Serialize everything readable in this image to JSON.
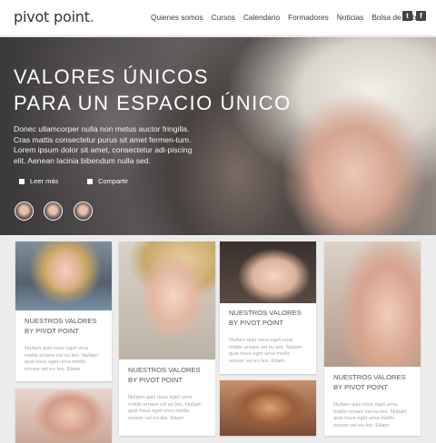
{
  "brand": {
    "name_main": "pivot point",
    "dot": "."
  },
  "nav": {
    "items": [
      "Quienes somos",
      "Cursos",
      "Calendario",
      "Formadores",
      "Noticias",
      "Bolsa de trabajo"
    ]
  },
  "social": {
    "twitter_icon": "twitter-icon",
    "facebook_icon": "facebook-icon",
    "twitter_glyph": "t",
    "facebook_glyph": "f"
  },
  "hero": {
    "title_line1": "VALORES ÚNICOS",
    "title_line2": "PARA UN ESPACIO ÚNICO",
    "description": "Donec ullamcorper nulla non metus auctor fringilla. Cras mattis consectetur purus sit amet fermen-tum. Lorem ipsum dolor sit amet, consectetur adi-piscing elit. Aenean lacinia bibendum nulla sed.",
    "read_more": "Leer más",
    "share": "Compartir"
  },
  "cards": [
    {
      "title": "NUESTROS VALORES BY PIVOT POINT",
      "text": "Nullam quis risus eget urna mollis ornare vel eu leo. Nullam quis risus eget urna mollis ornare vel eu leo. Etiam"
    },
    {
      "title": "NUESTROS VALORES BY PIVOT POINT",
      "text": "Nullam quis risus eget urna mollis ornare vel eu leo. Nullam quis risus eget urna mollis ornare vel eu leo. Etiam"
    },
    {
      "title": "NUESTROS VALORES BY PIVOT POINT",
      "text": "Nullam quis risus eget urna mollis ornare vel eu leo. Nullam quis risus eget urna mollis ornare vel eu leo. Etiam"
    },
    {
      "title": "NUESTROS VALORES BY PIVOT POINT",
      "text": "Nullam quis risus eget urna mollis ornare vel eu leo. Nullam quis risus eget urna mollis ornare vel eu leo. Etiam"
    }
  ]
}
